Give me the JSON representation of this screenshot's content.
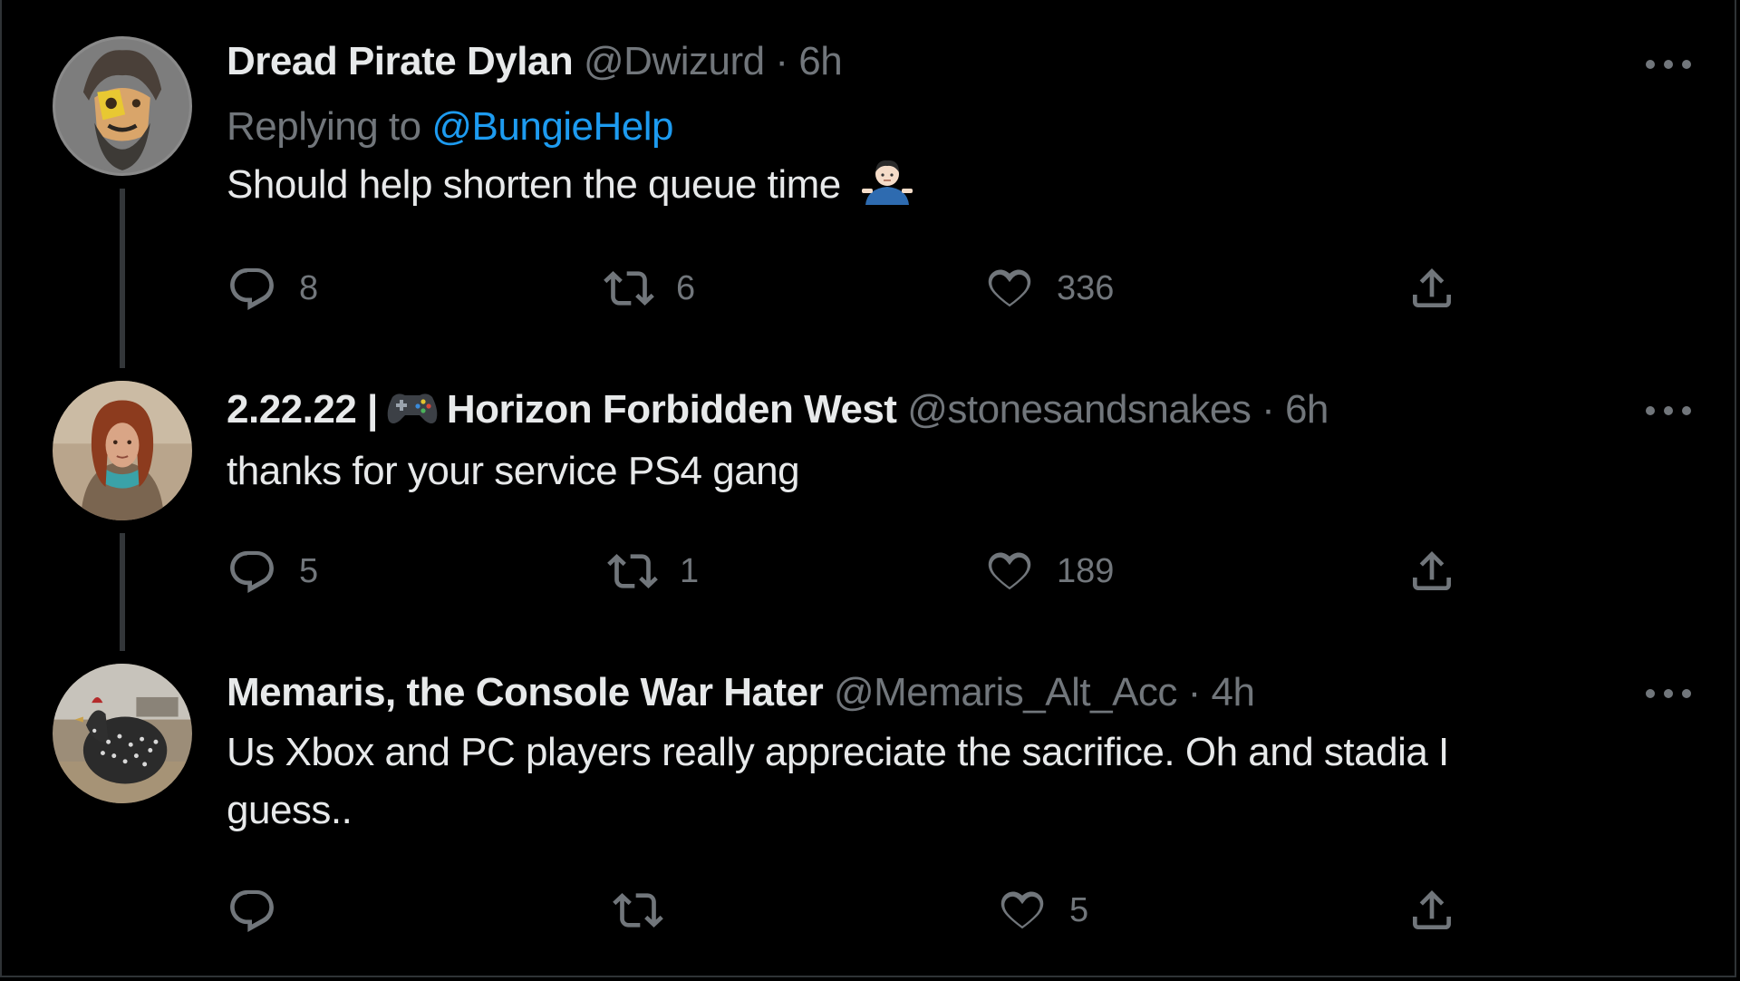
{
  "tweets": [
    {
      "name": "Dread Pirate Dylan",
      "handle": "@Dwizurd",
      "separator": " · ",
      "time": "6h",
      "replying_prefix": "Replying to ",
      "replying_to": "@BungieHelp",
      "text": "Should help shorten the queue time",
      "emoji": "person-shrugging",
      "replies": "8",
      "retweets": "6",
      "likes": "336"
    },
    {
      "name_prefix": "2.22.22 |",
      "name_emoji": "game-controller",
      "name": "Horizon Forbidden West",
      "handle": "@stonesandsnakes",
      "separator": " · ",
      "time": "6h",
      "text": "thanks for your service PS4 gang",
      "replies": "5",
      "retweets": "1",
      "likes": "189"
    },
    {
      "name": "Memaris, the Console War Hater",
      "handle": "@Memaris_Alt_Acc",
      "separator": " · ",
      "time": "4h",
      "text_line1": "Us Xbox and PC players really appreciate the sacrifice. Oh and stadia I",
      "text_line2": "guess..",
      "replies": "",
      "retweets": "",
      "likes": "5"
    }
  ],
  "colors": {
    "background": "#000000",
    "text": "#e7e9ea",
    "muted": "#71767b",
    "link": "#1d9bf0",
    "thread_line": "#333639"
  }
}
